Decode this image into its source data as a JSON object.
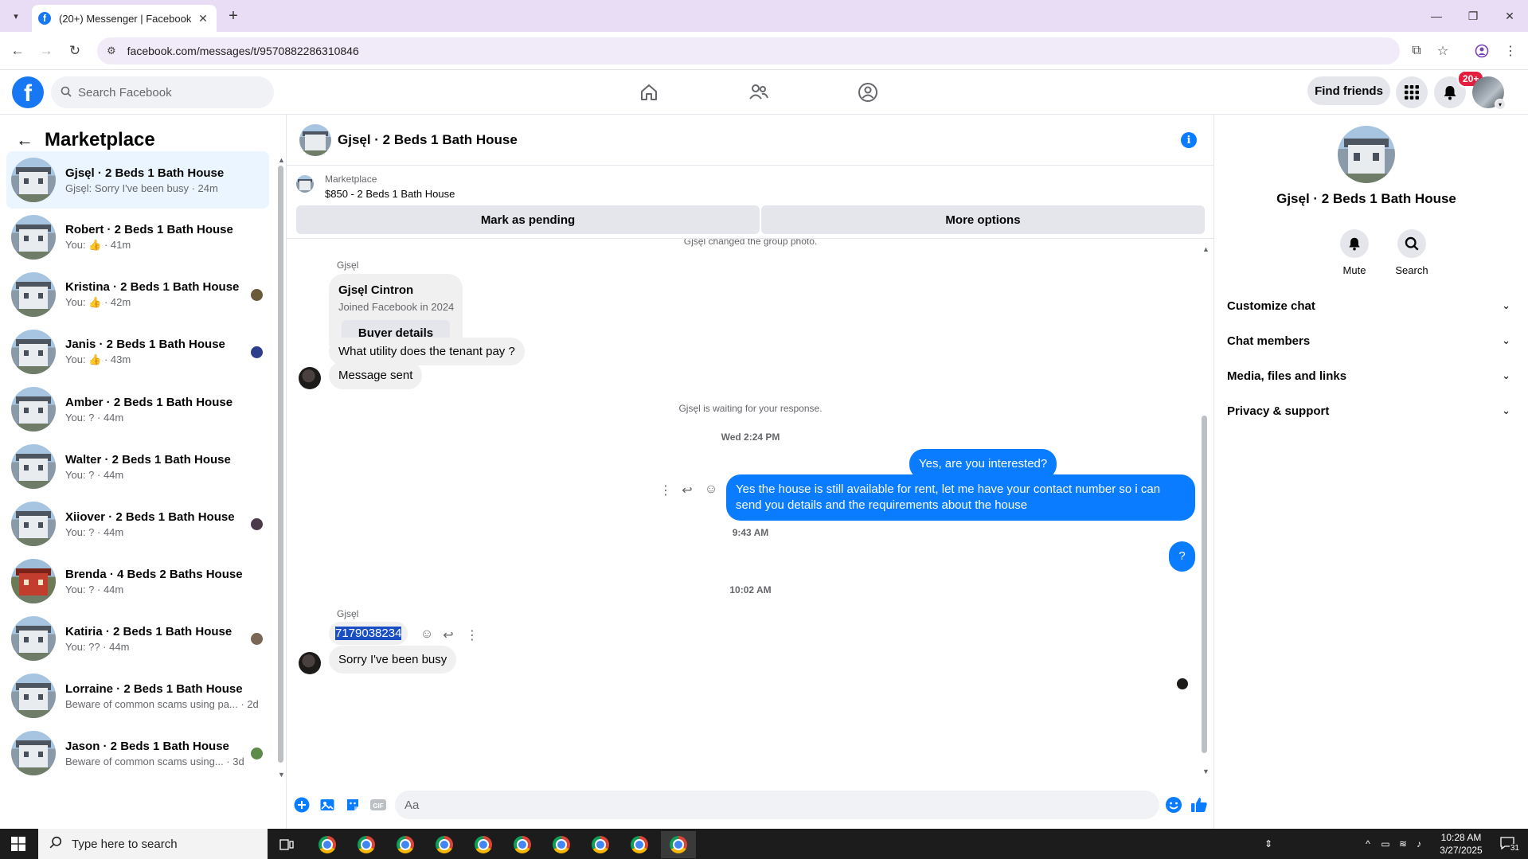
{
  "browser": {
    "tab_title": "(20+) Messenger | Facebook",
    "url": "facebook.com/messages/t/9570882286310846"
  },
  "facebook": {
    "search_placeholder": "Search Facebook",
    "find_friends": "Find friends",
    "notification_badge": "20+"
  },
  "left": {
    "title": "Marketplace",
    "conversations": [
      {
        "name": "Gjsęl · 2 Beds 1 Bath House",
        "preview": "Gjsęl: Sorry I've been busy · 24m",
        "active": true
      },
      {
        "name": "Robert · 2 Beds 1 Bath House",
        "preview": "You: 👍 · 41m"
      },
      {
        "name": "Kristina · 2 Beds 1 Bath House",
        "preview": "You: 👍 · 42m"
      },
      {
        "name": "Janis · 2 Beds 1 Bath House",
        "preview": "You: 👍 · 43m"
      },
      {
        "name": "Amber · 2 Beds 1 Bath House",
        "preview": "You: ? · 44m"
      },
      {
        "name": "Walter · 2 Beds 1 Bath House",
        "preview": "You: ? · 44m"
      },
      {
        "name": "Xiiover · 2 Beds 1 Bath House",
        "preview": "You: ? · 44m"
      },
      {
        "name": "Brenda · 4 Beds 2 Baths House",
        "preview": "You: ? · 44m"
      },
      {
        "name": "Katiria · 2 Beds 1 Bath House",
        "preview": "You: ?? · 44m"
      },
      {
        "name": "Lorraine · 2 Beds 1 Bath House",
        "preview": "Beware of common scams using pa... · 2d"
      },
      {
        "name": "Jason · 2 Beds 1 Bath House",
        "preview": "Beware of common scams using... · 3d"
      }
    ]
  },
  "chat": {
    "title": "Gjsęl · 2 Beds 1 Bath House",
    "marketplace_label": "Marketplace",
    "listing": "$850 - 2 Beds 1 Bath House",
    "mark_pending": "Mark as pending",
    "more_options": "More options",
    "group_photo_note": "Gjsęl changed the group photo.",
    "sender_name": "Gjsęl",
    "buyer_name": "Gjsęl Cintron",
    "buyer_joined": "Joined Facebook in 2024",
    "buyer_details": "Buyer details",
    "msg_utility": "What utility does the tenant pay ?",
    "msg_sent": "Message sent",
    "waiting_note": "Gjsęl is waiting for your response.",
    "ts1": "Wed 2:24 PM",
    "out1": "Yes, are you interested?",
    "out2": "Yes the house is still available for rent, let me have your contact number so i can send you details and the requirements about the house",
    "ts2": "9:43 AM",
    "out3": "?",
    "ts3": "10:02 AM",
    "sender_name2": "Gjsęl",
    "in_number": "7179038234",
    "in_busy": "Sorry I've been busy",
    "composer_placeholder": "Aa"
  },
  "right": {
    "name": "Gjsęl · 2 Beds 1 Bath House",
    "mute": "Mute",
    "search": "Search",
    "sections": [
      "Customize chat",
      "Chat members",
      "Media, files and links",
      "Privacy & support"
    ]
  },
  "taskbar": {
    "search_placeholder": "Type here to search",
    "time": "10:28 AM",
    "date": "3/27/2025",
    "notifications": "31"
  },
  "colors": {
    "messenger_blue": "#0a7cff",
    "facebook_blue": "#1877f2",
    "active_row": "#ebf5ff"
  }
}
